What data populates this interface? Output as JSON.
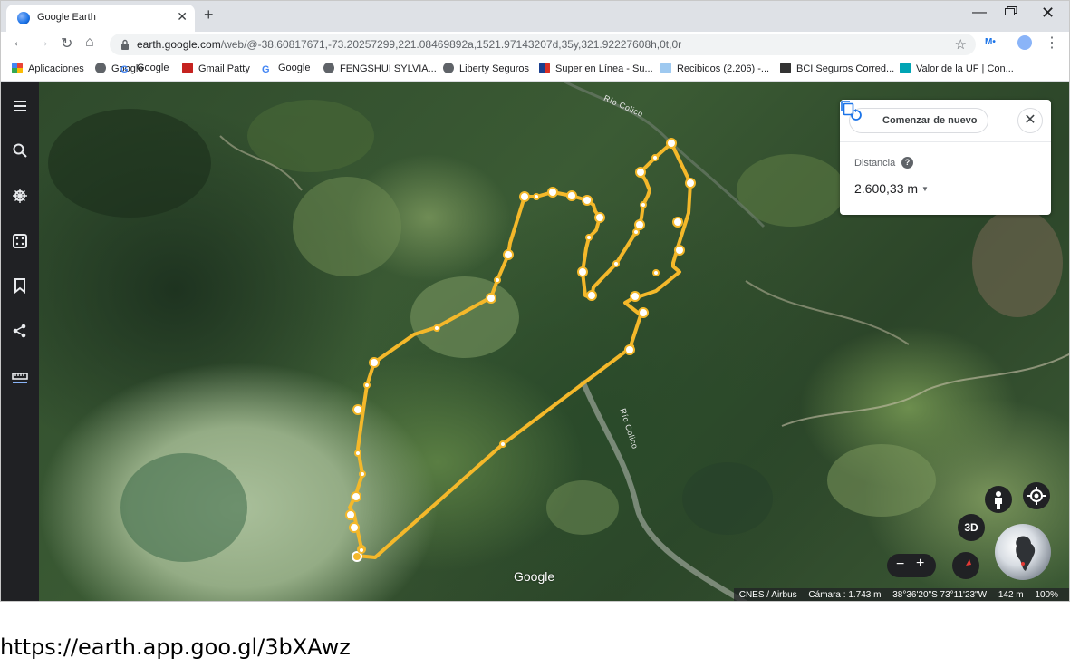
{
  "browser": {
    "tab_title": "Google Earth",
    "new_tab": "+",
    "url_host": "earth.google.com",
    "url_path": "/web/@-38.60817671,-73.20257299,221.08469892a,1521.97143207d,35y,321.92227608h,0t,0r",
    "window_min": "—",
    "window_close": "✕"
  },
  "bookmarks": [
    {
      "label": "Aplicaciones",
      "icon": "apps-grid-icon",
      "color": "#e8453c"
    },
    {
      "label": "Google",
      "icon": "globe-icon",
      "color": "#5f6368"
    },
    {
      "label": "Google",
      "icon": "google-g-icon",
      "color": "#4285f4"
    },
    {
      "label": "Gmail Patty",
      "icon": "gmail-icon",
      "color": "#c5221f"
    },
    {
      "label": "Google",
      "icon": "google-g-icon",
      "color": "#4285f4"
    },
    {
      "label": "FENGSHUI SYLVIA...",
      "icon": "globe-icon",
      "color": "#5f6368"
    },
    {
      "label": "Liberty Seguros",
      "icon": "globe-icon",
      "color": "#5f6368"
    },
    {
      "label": "Super en Línea - Su...",
      "icon": "store-icon",
      "color": "#d93025"
    },
    {
      "label": "Recibidos (2.206) -...",
      "icon": "outlook-icon",
      "color": "#0078d4"
    },
    {
      "label": "BCI Seguros Corred...",
      "icon": "bci-icon",
      "color": "#333333"
    },
    {
      "label": "Valor de la UF | Con...",
      "icon": "uf-icon",
      "color": "#00a4b4"
    }
  ],
  "measure": {
    "restart_label": "Comenzar de nuevo",
    "distance_label": "Distancia",
    "help": "?",
    "distance_value": "2.600,33 m",
    "close": "✕"
  },
  "map": {
    "river_label_1": "Río Colico",
    "river_label_2": "Río Colico",
    "google_logo": "Google",
    "btn_3d": "3D",
    "zoom_minus": "−",
    "zoom_plus": "+",
    "path_color": "#f4b82a"
  },
  "status_bar": {
    "attribution": "CNES / Airbus",
    "camera": "Cámara : 1.743 m",
    "coords": "38°36'20\"S 73°11'23\"W",
    "scale": "142 m",
    "zoom": "100%"
  },
  "caption": "https://earth.app.goo.gl/3bXAwz"
}
